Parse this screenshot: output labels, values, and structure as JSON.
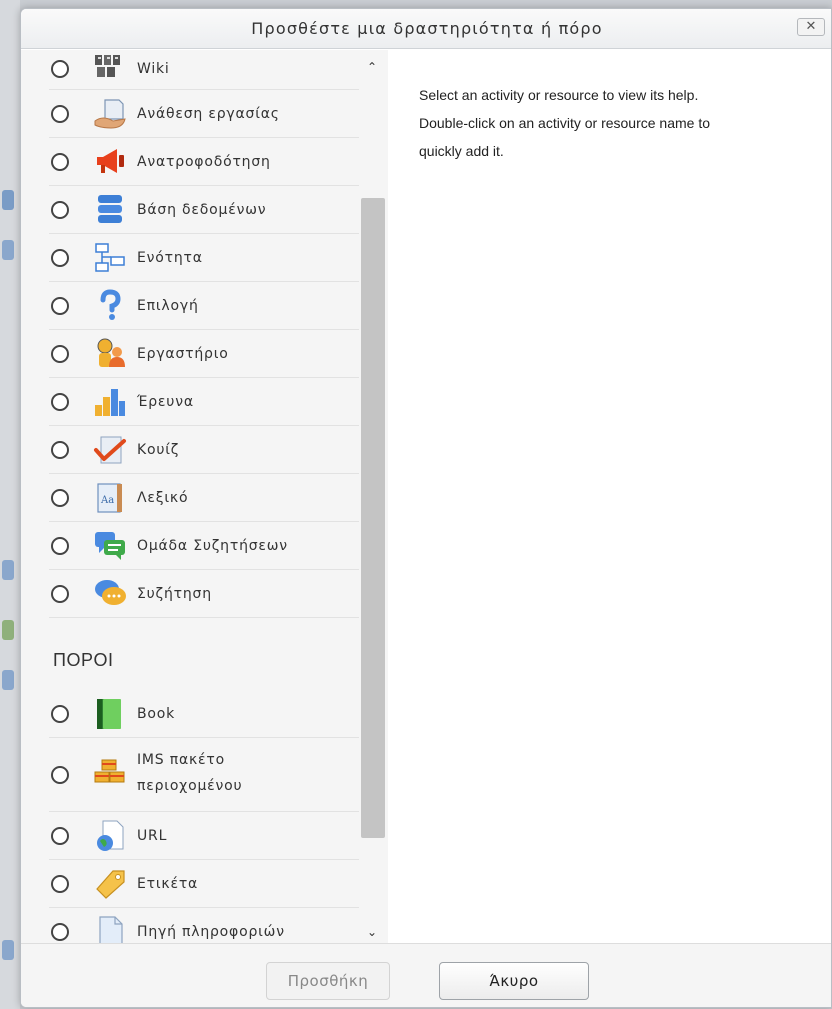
{
  "dialog": {
    "title": "Προσθέστε μια δραστηριότητα ή πόρο",
    "close_label": "✕"
  },
  "activities": [
    {
      "label": "Wiki",
      "icon": "wiki-icon"
    },
    {
      "label": "Ανάθεση εργασίας",
      "icon": "assignment-icon"
    },
    {
      "label": "Ανατροφοδότηση",
      "icon": "feedback-megaphone-icon"
    },
    {
      "label": "Βάση δεδομένων",
      "icon": "database-icon"
    },
    {
      "label": "Ενότητα",
      "icon": "lesson-icon"
    },
    {
      "label": "Επιλογή",
      "icon": "choice-question-icon"
    },
    {
      "label": "Εργαστήριο",
      "icon": "workshop-icon"
    },
    {
      "label": "Έρευνα",
      "icon": "survey-chart-icon"
    },
    {
      "label": "Κουίζ",
      "icon": "quiz-check-icon"
    },
    {
      "label": "Λεξικό",
      "icon": "glossary-icon"
    },
    {
      "label": "Ομάδα Συζητήσεων",
      "icon": "chat-icon"
    },
    {
      "label": "Συζήτηση",
      "icon": "forum-icon"
    }
  ],
  "resources_heading": "ΠΟΡΟΙ",
  "resources": [
    {
      "label": "Book",
      "icon": "book-icon"
    },
    {
      "label": "IMS πακέτο",
      "label2": "περιοχομένου",
      "icon": "ims-package-icon"
    },
    {
      "label": "URL",
      "icon": "url-globe-icon"
    },
    {
      "label": "Ετικέτα",
      "icon": "label-tag-icon"
    },
    {
      "label": "Πηγή πληροφοριών",
      "icon": "file-page-icon"
    }
  ],
  "help": {
    "line1": "Select an activity or resource to view its help.",
    "line2": "Double-click on an activity or resource name to",
    "line3": "quickly add it."
  },
  "buttons": {
    "add": "Προσθήκη",
    "cancel": "Άκυρο"
  }
}
